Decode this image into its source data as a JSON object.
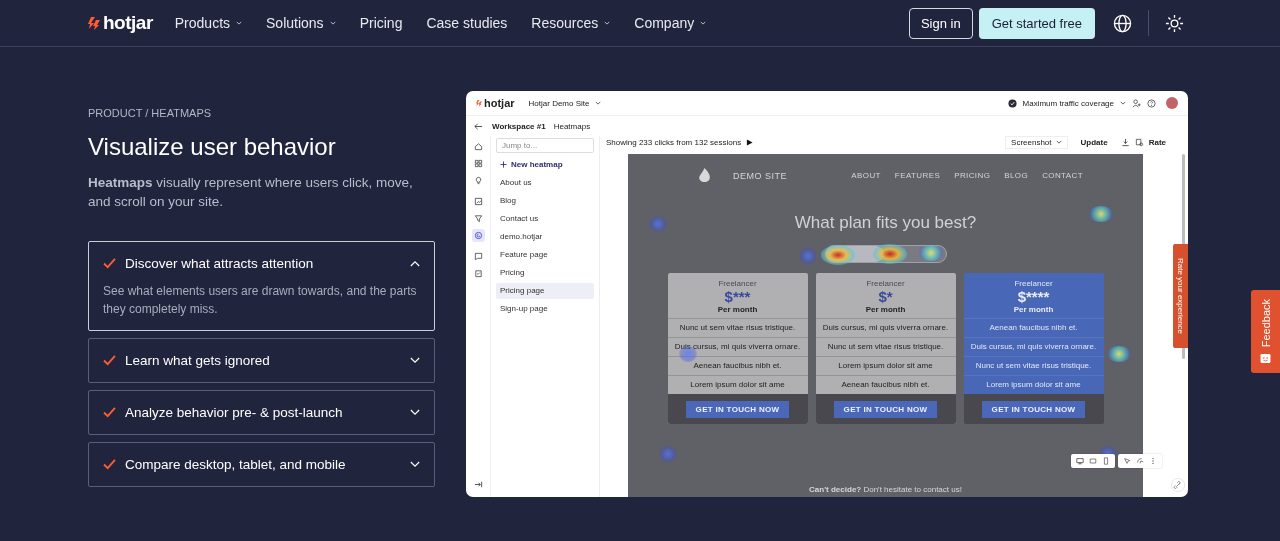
{
  "nav": {
    "logo": "hotjar",
    "links": [
      {
        "label": "Products",
        "dropdown": true
      },
      {
        "label": "Solutions",
        "dropdown": true
      },
      {
        "label": "Pricing",
        "dropdown": false
      },
      {
        "label": "Case studies",
        "dropdown": false
      },
      {
        "label": "Resources",
        "dropdown": true
      },
      {
        "label": "Company",
        "dropdown": true
      }
    ],
    "sign_in": "Sign in",
    "cta": "Get started free"
  },
  "hero": {
    "eyebrow": "PRODUCT / HEATMAPS",
    "title": "Visualize user behavior",
    "lead": "**Heatmaps** visually represent where users click, move, and scroll on your site."
  },
  "features": [
    {
      "title": "Discover what attracts attention",
      "body": "See what elements users are drawn towards, and the parts they completely miss.",
      "expanded": true
    },
    {
      "title": "Learn what gets ignored",
      "expanded": false
    },
    {
      "title": "Analyze behavior pre- & post-launch",
      "expanded": false
    },
    {
      "title": "Compare desktop, tablet, and mobile",
      "expanded": false
    }
  ],
  "app": {
    "logo": "hotjar",
    "site": "Hotjar Demo Site",
    "coverage": "Maximum traffic coverage",
    "breadcrumb": [
      "Workspace #1",
      "Heatmaps"
    ],
    "rail": [
      {
        "kind": "home",
        "selected": false
      },
      {
        "kind": "grid",
        "selected": false
      },
      {
        "kind": "bulb",
        "selected": false
      },
      {
        "kind": "chart",
        "selected": false
      },
      {
        "kind": "funnel",
        "selected": false
      },
      {
        "kind": "heatmap",
        "selected": true
      },
      {
        "kind": "chat",
        "selected": false
      },
      {
        "kind": "survey",
        "selected": false
      }
    ],
    "search": {
      "placeholder": "Jump to..."
    },
    "new_button": "New heatmap",
    "pages": [
      {
        "label": "About us",
        "selected": false
      },
      {
        "label": "Blog",
        "selected": false
      },
      {
        "label": "Contact us",
        "selected": false
      },
      {
        "label": "demo.hotjar",
        "selected": false
      },
      {
        "label": "Feature page",
        "selected": false
      },
      {
        "label": "Pricing",
        "selected": false
      },
      {
        "label": "Pricing page",
        "selected": true
      },
      {
        "label": "Sign-up page",
        "selected": false
      }
    ],
    "summary": "Showing 233 clicks from 132 sessions",
    "screenshot": "Screenshot",
    "update": "Update",
    "rate": "Rate",
    "canvas": {
      "site_name": "DEMO SITE",
      "site_nav": [
        "ABOUT",
        "FEATURES",
        "PRICING",
        "BLOG",
        "CONTACT"
      ],
      "headline": "What plan fits you best?",
      "plans": [
        {
          "tier": "Freelancer",
          "price": "$***",
          "period": "Per month",
          "features": [
            "Nunc ut sem vitae risus tristique.",
            "Duis cursus, mi quis viverra ornare.",
            "Aenean faucibus nibh et.",
            "Lorem ipsum dolor sit ame"
          ],
          "cta": "GET IN TOUCH NOW",
          "featured": false
        },
        {
          "tier": "Freelancer",
          "price": "$*",
          "period": "Per month",
          "features": [
            "Duis cursus, mi quis viverra ornare.",
            "Nunc ut sem vitae risus tristique.",
            "Lorem ipsum dolor sit ame",
            "Aenean faucibus nibh et."
          ],
          "cta": "GET IN TOUCH NOW",
          "featured": false
        },
        {
          "tier": "Freelancer",
          "price": "$****",
          "period": "Per month",
          "features": [
            "Aenean faucibus nibh et.",
            "Duis cursus, mi quis viverra ornare.",
            "Nunc ut sem vitae risus tristique.",
            "Lorem ipsum dolor sit ame"
          ],
          "cta": "GET IN TOUCH NOW",
          "featured": true
        }
      ],
      "footer": "**Can't decide?** Don't hesitate to contact us!"
    },
    "rate_tab": "Rate your experience"
  },
  "feedback_tab": "Feedback"
}
